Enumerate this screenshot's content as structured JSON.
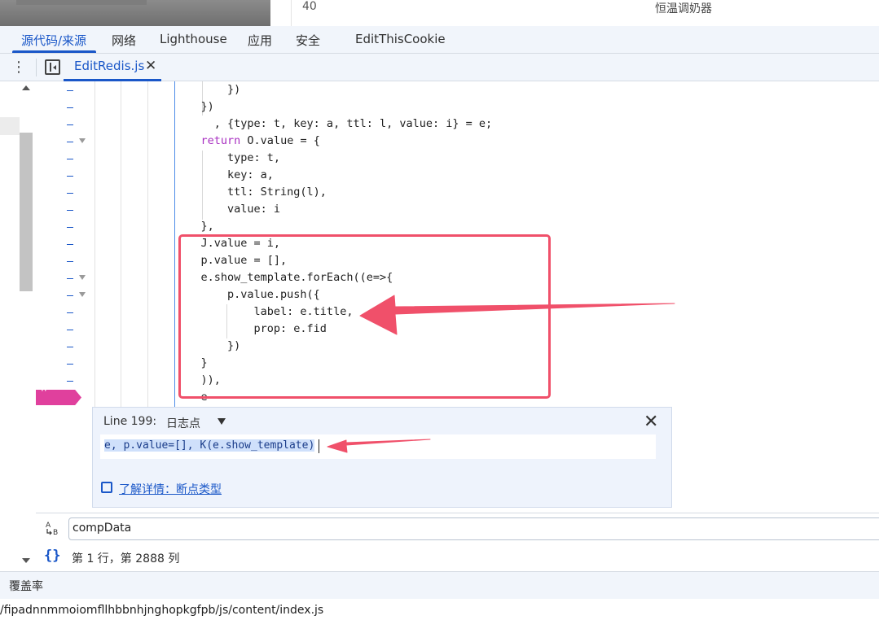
{
  "page": {
    "row_number": "40",
    "device_name": "恒温调奶器"
  },
  "tabs": [
    "源代码/来源",
    "网络",
    "Lighthouse",
    "应用",
    "安全",
    "EditThisCookie"
  ],
  "active_tab": "源代码/来源",
  "file_tab": {
    "name": "EditRedis.js",
    "close": "✕"
  },
  "code_lines": [
    "        })",
    "    })",
    "      , {type: t, key: a, ttl: l, value: i} = e;",
    "    return O.value = {",
    "        type: t,",
    "        key: a,",
    "        ttl: String(l),",
    "        value: i",
    "    },",
    "    J.value = i,",
    "    p.value = [],",
    "    e.show_template.forEach((e=>{",
    "        p.value.push({",
    "            label: e.title,",
    "            prop: e.fid",
    "        })",
    "    }",
    "    )),",
    "    e"
  ],
  "logpoint": {
    "line_label": "Line 199:",
    "type_label": "日志点",
    "expression": "e, p.value=[], K(e.show_template)",
    "learn_more": "了解详情：断点类型"
  },
  "search": {
    "value": "compData",
    "case_icon": "A B"
  },
  "status": {
    "position": "第 1 行，第 2888 列"
  },
  "drawer": {
    "title": "覆盖率"
  },
  "bottom_url": "/fipadnnmmoiomfllhbbnhjnghopkgfpb/js/content/index.js",
  "colors": {
    "accent": "#1a57c8",
    "annotation_red": "#f0506a",
    "logpoint_pink": "#e0409d"
  }
}
